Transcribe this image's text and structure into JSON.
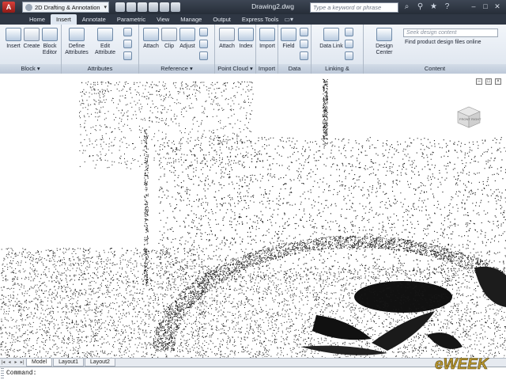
{
  "app": {
    "workspace": "2D Drafting & Annotation",
    "document_title": "Drawing2.dwg",
    "search_placeholder": "Type a keyword or phrase"
  },
  "tabs": [
    {
      "label": "Home",
      "active": false
    },
    {
      "label": "Insert",
      "active": true
    },
    {
      "label": "Annotate",
      "active": false
    },
    {
      "label": "Parametric",
      "active": false
    },
    {
      "label": "View",
      "active": false
    },
    {
      "label": "Manage",
      "active": false
    },
    {
      "label": "Output",
      "active": false
    },
    {
      "label": "Express Tools",
      "active": false
    }
  ],
  "ribbon": {
    "panels": [
      {
        "title": "Block ▾",
        "tools": [
          "Insert",
          "Create",
          "Block Editor"
        ]
      },
      {
        "title": "Attributes",
        "tools": [
          "Define Attributes",
          "Edit Attribute"
        ]
      },
      {
        "title": "Reference ▾",
        "tools": [
          "Attach",
          "Clip",
          "Adjust"
        ]
      },
      {
        "title": "Point Cloud ▾",
        "tools": [
          "Attach",
          "Index"
        ]
      },
      {
        "title": "Import",
        "tools": [
          "Import"
        ]
      },
      {
        "title": "Data",
        "tools": [
          "Field"
        ]
      },
      {
        "title": "Linking & Extraction",
        "tools": [
          "Data Link"
        ]
      },
      {
        "title": "Content",
        "tools": [
          "Design Center"
        ]
      }
    ],
    "content_search_placeholder": "Seek design content",
    "content_link": "Find product design files online"
  },
  "viewcube": {
    "front": "FRONT",
    "right": "RIGHT"
  },
  "layout_tabs": [
    {
      "label": "Model",
      "active": true
    },
    {
      "label": "Layout1",
      "active": false
    },
    {
      "label": "Layout2",
      "active": false
    }
  ],
  "command": {
    "prompt": "Command:"
  },
  "watermark": {
    "text": "eWEEK"
  },
  "colors": {
    "title_bar": "#262d38",
    "ribbon": "#dce4ee",
    "logo": "#c8312b",
    "watermark": "#b8962e"
  }
}
